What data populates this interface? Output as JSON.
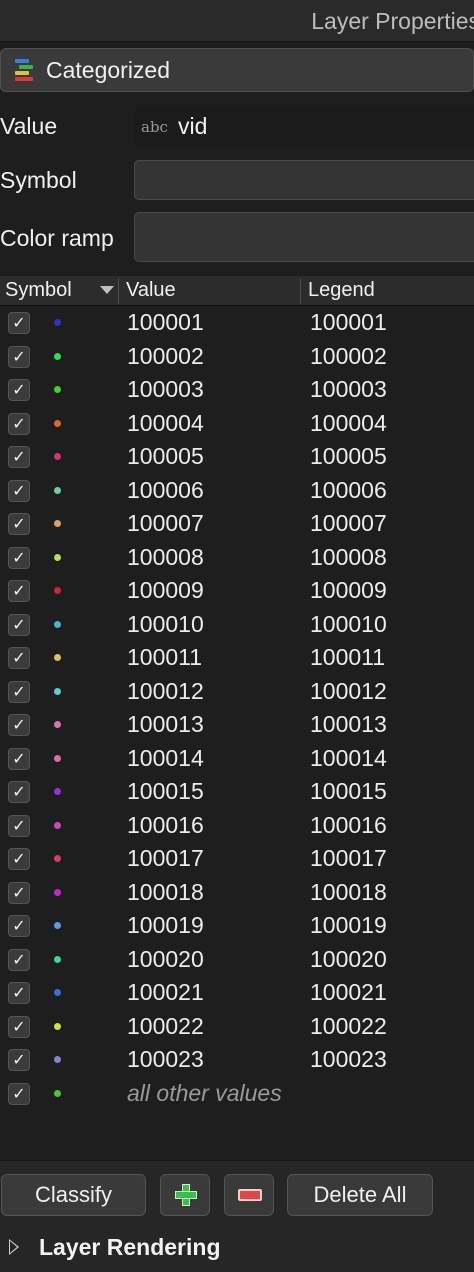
{
  "window": {
    "title": "Layer Properties"
  },
  "renderer": {
    "label": "Categorized",
    "icon": "categorized-icon"
  },
  "form": {
    "value_label": "Value",
    "value_field": {
      "type_badge": "abc",
      "value": "vid"
    },
    "symbol_label": "Symbol",
    "color_ramp_label": "Color ramp"
  },
  "table": {
    "headers": {
      "symbol": "Symbol",
      "value": "Value",
      "legend": "Legend"
    },
    "check_glyph": "✓",
    "rows": [
      {
        "value": "100001",
        "legend": "100001",
        "color": "#2b34c9"
      },
      {
        "value": "100002",
        "legend": "100002",
        "color": "#2fe04a"
      },
      {
        "value": "100003",
        "legend": "100003",
        "color": "#3bd22a"
      },
      {
        "value": "100004",
        "legend": "100004",
        "color": "#d86a28"
      },
      {
        "value": "100005",
        "legend": "100005",
        "color": "#d6307a"
      },
      {
        "value": "100006",
        "legend": "100006",
        "color": "#6fcf95"
      },
      {
        "value": "100007",
        "legend": "100007",
        "color": "#e0a064"
      },
      {
        "value": "100008",
        "legend": "100008",
        "color": "#b6dc58"
      },
      {
        "value": "100009",
        "legend": "100009",
        "color": "#d4262a"
      },
      {
        "value": "100010",
        "legend": "100010",
        "color": "#3fb6d8"
      },
      {
        "value": "100011",
        "legend": "100011",
        "color": "#dcc156"
      },
      {
        "value": "100012",
        "legend": "100012",
        "color": "#58d0d2"
      },
      {
        "value": "100013",
        "legend": "100013",
        "color": "#d873b8"
      },
      {
        "value": "100014",
        "legend": "100014",
        "color": "#e06aa6"
      },
      {
        "value": "100015",
        "legend": "100015",
        "color": "#9a2ce0"
      },
      {
        "value": "100016",
        "legend": "100016",
        "color": "#c84ac8"
      },
      {
        "value": "100017",
        "legend": "100017",
        "color": "#d63e5e"
      },
      {
        "value": "100018",
        "legend": "100018",
        "color": "#c426d0"
      },
      {
        "value": "100019",
        "legend": "100019",
        "color": "#5a9ed8"
      },
      {
        "value": "100020",
        "legend": "100020",
        "color": "#2ee08a"
      },
      {
        "value": "100021",
        "legend": "100021",
        "color": "#3470e0"
      },
      {
        "value": "100022",
        "legend": "100022",
        "color": "#d2e040"
      },
      {
        "value": "100023",
        "legend": "100023",
        "color": "#7a86d6"
      },
      {
        "value": "all other values",
        "legend": "",
        "color": "#4cc43a",
        "other": true
      }
    ]
  },
  "buttons": {
    "classify": "Classify",
    "add_icon": "plus-icon",
    "remove_icon": "minus-icon",
    "delete_all": "Delete All"
  },
  "section": {
    "title": "Layer Rendering"
  }
}
